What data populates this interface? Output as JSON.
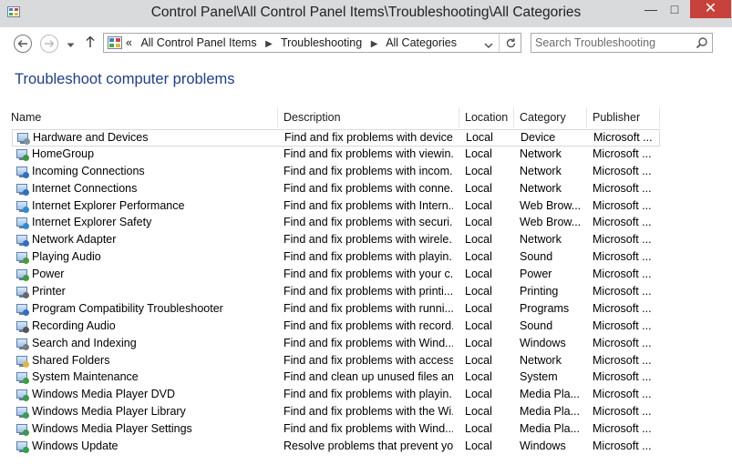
{
  "window": {
    "title": "Control Panel\\All Control Panel Items\\Troubleshooting\\All Categories",
    "minimize": "—",
    "maximize": "□",
    "close": "✕"
  },
  "nav": {
    "back_icon": "back-arrow-icon",
    "forward_icon": "forward-arrow-icon",
    "recent_icon": "chevron-down-icon",
    "up_icon": "up-arrow-icon"
  },
  "address": {
    "overflow": "«",
    "crumbs": [
      "All Control Panel Items",
      "Troubleshooting",
      "All Categories"
    ],
    "separator": "▶"
  },
  "search": {
    "placeholder": "Search Troubleshooting"
  },
  "heading": "Troubleshoot computer problems",
  "columns": {
    "name": "Name",
    "description": "Description",
    "location": "Location",
    "category": "Category",
    "publisher": "Publisher"
  },
  "rows": [
    {
      "name": "Hardware and Devices",
      "description": "Find and fix problems with device...",
      "location": "Local",
      "category": "Device",
      "publisher": "Microsoft ...",
      "icon": "hardware-icon"
    },
    {
      "name": "HomeGroup",
      "description": "Find and fix problems with viewin...",
      "location": "Local",
      "category": "Network",
      "publisher": "Microsoft ...",
      "icon": "homegroup-icon"
    },
    {
      "name": "Incoming Connections",
      "description": "Find and fix problems with incom...",
      "location": "Local",
      "category": "Network",
      "publisher": "Microsoft ...",
      "icon": "network-icon"
    },
    {
      "name": "Internet Connections",
      "description": "Find and fix problems with conne...",
      "location": "Local",
      "category": "Network",
      "publisher": "Microsoft ...",
      "icon": "network-icon"
    },
    {
      "name": "Internet Explorer Performance",
      "description": "Find and fix problems with Intern...",
      "location": "Local",
      "category": "Web Brow...",
      "publisher": "Microsoft ...",
      "icon": "ie-icon"
    },
    {
      "name": "Internet Explorer Safety",
      "description": "Find and fix problems with securi...",
      "location": "Local",
      "category": "Web Brow...",
      "publisher": "Microsoft ...",
      "icon": "ie-icon"
    },
    {
      "name": "Network Adapter",
      "description": "Find and fix problems with wirele...",
      "location": "Local",
      "category": "Network",
      "publisher": "Microsoft ...",
      "icon": "network-icon"
    },
    {
      "name": "Playing Audio",
      "description": "Find and fix problems with playin...",
      "location": "Local",
      "category": "Sound",
      "publisher": "Microsoft ...",
      "icon": "audio-icon"
    },
    {
      "name": "Power",
      "description": "Find and fix problems with your c...",
      "location": "Local",
      "category": "Power",
      "publisher": "Microsoft ...",
      "icon": "power-icon"
    },
    {
      "name": "Printer",
      "description": "Find and fix problems with printi...",
      "location": "Local",
      "category": "Printing",
      "publisher": "Microsoft ...",
      "icon": "printer-icon"
    },
    {
      "name": "Program Compatibility Troubleshooter",
      "description": "Find and fix problems with runni...",
      "location": "Local",
      "category": "Programs",
      "publisher": "Microsoft ...",
      "icon": "program-icon"
    },
    {
      "name": "Recording Audio",
      "description": "Find and fix problems with record...",
      "location": "Local",
      "category": "Sound",
      "publisher": "Microsoft ...",
      "icon": "microphone-icon"
    },
    {
      "name": "Search and Indexing",
      "description": "Find and fix problems with Wind...",
      "location": "Local",
      "category": "Windows",
      "publisher": "Microsoft ...",
      "icon": "search-icon"
    },
    {
      "name": "Shared Folders",
      "description": "Find and fix problems with access...",
      "location": "Local",
      "category": "Network",
      "publisher": "Microsoft ...",
      "icon": "folder-icon"
    },
    {
      "name": "System Maintenance",
      "description": "Find and clean up unused files an...",
      "location": "Local",
      "category": "System",
      "publisher": "Microsoft ...",
      "icon": "maintenance-icon"
    },
    {
      "name": "Windows Media Player DVD",
      "description": "Find and fix problems with playin...",
      "location": "Local",
      "category": "Media Pla...",
      "publisher": "Microsoft ...",
      "icon": "media-player-icon"
    },
    {
      "name": "Windows Media Player Library",
      "description": "Find and fix problems with the Wi...",
      "location": "Local",
      "category": "Media Pla...",
      "publisher": "Microsoft ...",
      "icon": "media-player-icon"
    },
    {
      "name": "Windows Media Player Settings",
      "description": "Find and fix problems with Wind...",
      "location": "Local",
      "category": "Media Pla...",
      "publisher": "Microsoft ...",
      "icon": "media-player-icon"
    },
    {
      "name": "Windows Update",
      "description": "Resolve problems that prevent yo...",
      "location": "Local",
      "category": "Windows",
      "publisher": "Microsoft ...",
      "icon": "windows-update-icon"
    }
  ],
  "icon_colors": {
    "hardware-icon": "#7f8fa3",
    "homegroup-icon": "#3a9a3a",
    "network-icon": "#2e6fc6",
    "ie-icon": "#2a8bd6",
    "audio-icon": "#4a9a3a",
    "power-icon": "#3ca03c",
    "printer-icon": "#666666",
    "program-icon": "#2e6fc6",
    "microphone-icon": "#555555",
    "search-icon": "#7a7a7a",
    "folder-icon": "#e0b543",
    "maintenance-icon": "#3ca03c",
    "media-player-icon": "#3d9a4f",
    "windows-update-icon": "#2fa24a"
  },
  "colors": {
    "heading": "#1e3f8a",
    "close_button": "#c7423a",
    "titlebar": "#d9dadc"
  }
}
